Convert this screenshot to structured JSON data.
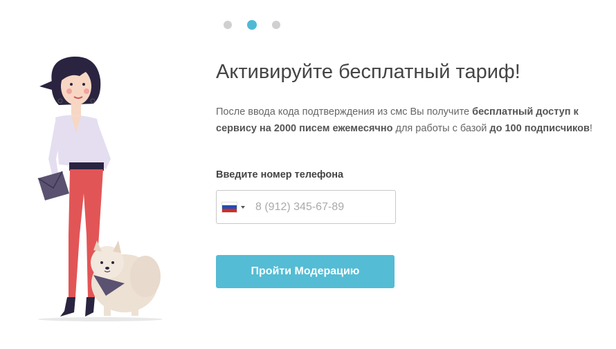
{
  "pagination": {
    "dots": [
      {
        "label": "step-1",
        "active": false
      },
      {
        "label": "step-2",
        "active": true
      },
      {
        "label": "step-3",
        "active": false
      }
    ],
    "active_color": "#4fb9d4",
    "inactive_color": "#d0d0d0"
  },
  "title": "Активируйте бесплатный тариф!",
  "description": {
    "part1": "После ввода кода подтверждения из смс Вы получите ",
    "bold1": "бесплатный доступ к сервису на 2000 писем ежемесячно",
    "part2": " для работы с базой ",
    "bold2": "до 100 подписчиков",
    "part3": "!"
  },
  "phone": {
    "label": "Введите номер телефона",
    "placeholder": "8 (912) 345-67-89",
    "value": "",
    "country_icon": "russia-flag-icon"
  },
  "submit_label": "Пройти Модерацию",
  "colors": {
    "button": "#54bcd4",
    "title": "#444444",
    "text": "#666666"
  }
}
